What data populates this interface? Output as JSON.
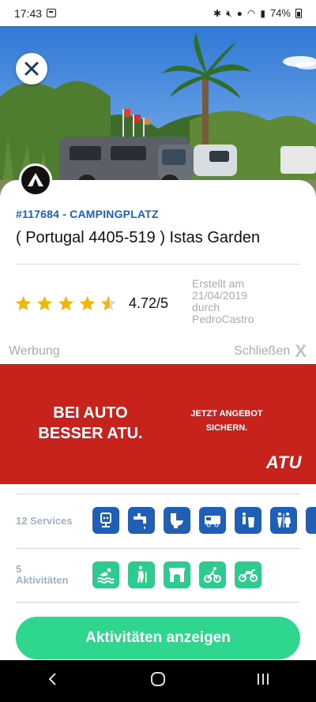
{
  "status": {
    "time": "17:43",
    "battery": "74%"
  },
  "header": {
    "close_icon": "close-icon"
  },
  "place": {
    "code": "#117684 - CAMPINGPLATZ",
    "title": "( Portugal 4405-519 ) Istas Garden",
    "rating_value": 4.72,
    "rating_text": "4.72/5",
    "created_line1": "Erstellt am",
    "created_line2": "21/04/2019",
    "created_line3": "durch",
    "created_line4": "PedroCastro"
  },
  "ad": {
    "label": "Werbung",
    "close_label": "Schließen",
    "close_x": "X",
    "headline_1": "BEI AUTO",
    "headline_2": "BESSER ATU.",
    "cta_1": "JETZT ANGEBOT",
    "cta_2": "SICHERN.",
    "brand": "ATU",
    "bg_color": "#c8221d"
  },
  "services": {
    "label": "12 Services",
    "icons": [
      "electricity-icon",
      "water-tap-icon",
      "toilet-icon",
      "camper-service-icon",
      "trash-icon",
      "restroom-icon",
      "shower-icon"
    ]
  },
  "activities": {
    "label_1": "5",
    "label_2": "Aktivitäten",
    "icons": [
      "swimming-icon",
      "hiking-icon",
      "monument-icon",
      "cycling-icon",
      "motorbike-icon"
    ]
  },
  "cta": {
    "label": "Aktivitäten anzeigen",
    "color": "#2ed68e"
  },
  "colors": {
    "accent_blue": "#1f5fb5",
    "accent_green": "#2ecb8e",
    "star": "#f2b705"
  }
}
